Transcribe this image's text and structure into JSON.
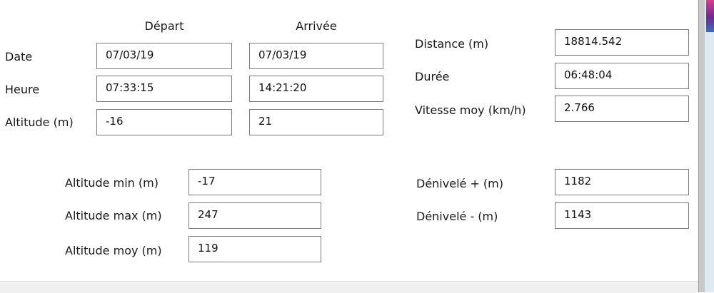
{
  "headers": {
    "depart": "Départ",
    "arrivee": "Arrivée"
  },
  "rows": {
    "date": {
      "label": "Date",
      "depart": "07/03/19",
      "arrivee": "07/03/19"
    },
    "heure": {
      "label": "Heure",
      "depart": "07:33:15",
      "arrivee": "14:21:20"
    },
    "altitude": {
      "label": "Altitude (m)",
      "depart": "-16",
      "arrivee": "21"
    }
  },
  "stats": {
    "distance": {
      "label": "Distance (m)",
      "value": "18814.542"
    },
    "duree": {
      "label": "Durée",
      "value": "06:48:04"
    },
    "vitesse": {
      "label": "Vitesse moy (km/h)",
      "value": "2.766"
    }
  },
  "altitudes": {
    "min": {
      "label": "Altitude min (m)",
      "value": "-17"
    },
    "max": {
      "label": "Altitude max (m)",
      "value": "247"
    },
    "moy": {
      "label": "Altitude moy (m)",
      "value": "119"
    }
  },
  "denivele": {
    "plus": {
      "label": "Dénivelé + (m)",
      "value": "1182"
    },
    "minus": {
      "label": "Dénivelé - (m)",
      "value": "1143"
    }
  }
}
